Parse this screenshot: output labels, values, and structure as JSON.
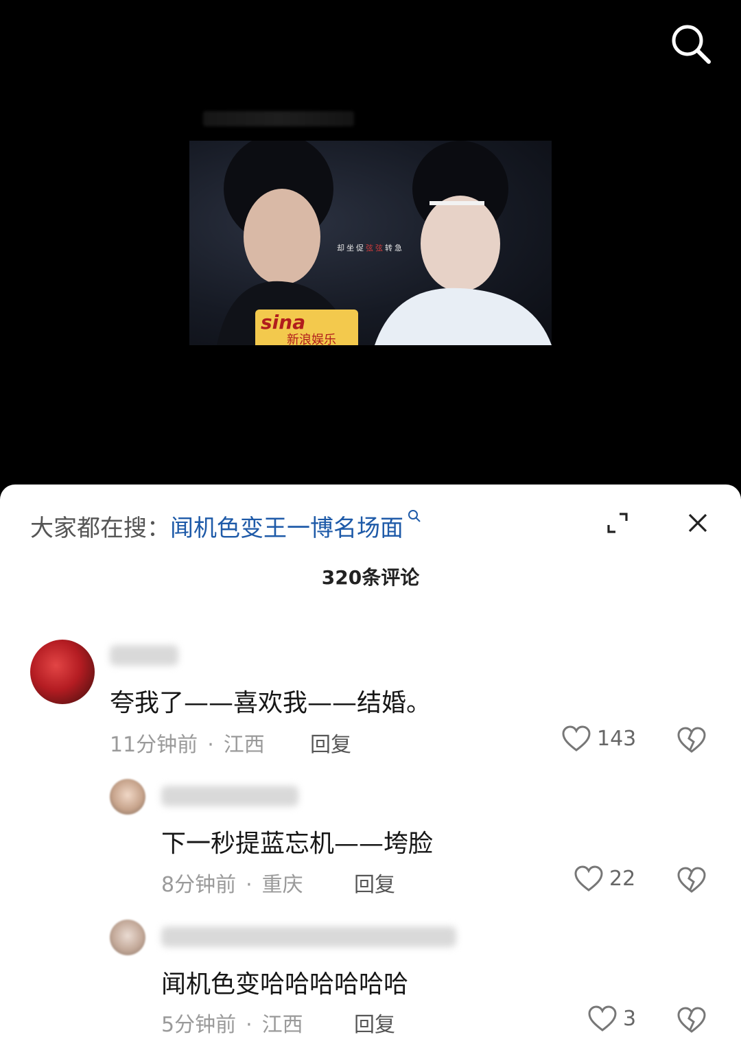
{
  "header": {
    "search_icon": "search-icon"
  },
  "video": {
    "caption_parts": [
      "却坐促",
      "弦弦",
      "转急"
    ],
    "sina_logo": "sina",
    "sina_sub": "新浪娱乐"
  },
  "sheet": {
    "hot_search_label": "大家都在搜：",
    "hot_search_keyword": "闻机色变王一博名场面",
    "comment_count": "320条评论"
  },
  "comments": [
    {
      "text": "夸我了——喜欢我——结婚。",
      "time": "11分钟前",
      "location": "江西",
      "reply": "回复",
      "likes": "143"
    },
    {
      "text": "下一秒提蓝忘机——垮脸",
      "time": "8分钟前",
      "location": "重庆",
      "reply": "回复",
      "likes": "22"
    },
    {
      "text": "闻机色变哈哈哈哈哈哈",
      "time": "5分钟前",
      "location": "江西",
      "reply": "回复",
      "likes": "3"
    }
  ],
  "meta_separator": "·"
}
